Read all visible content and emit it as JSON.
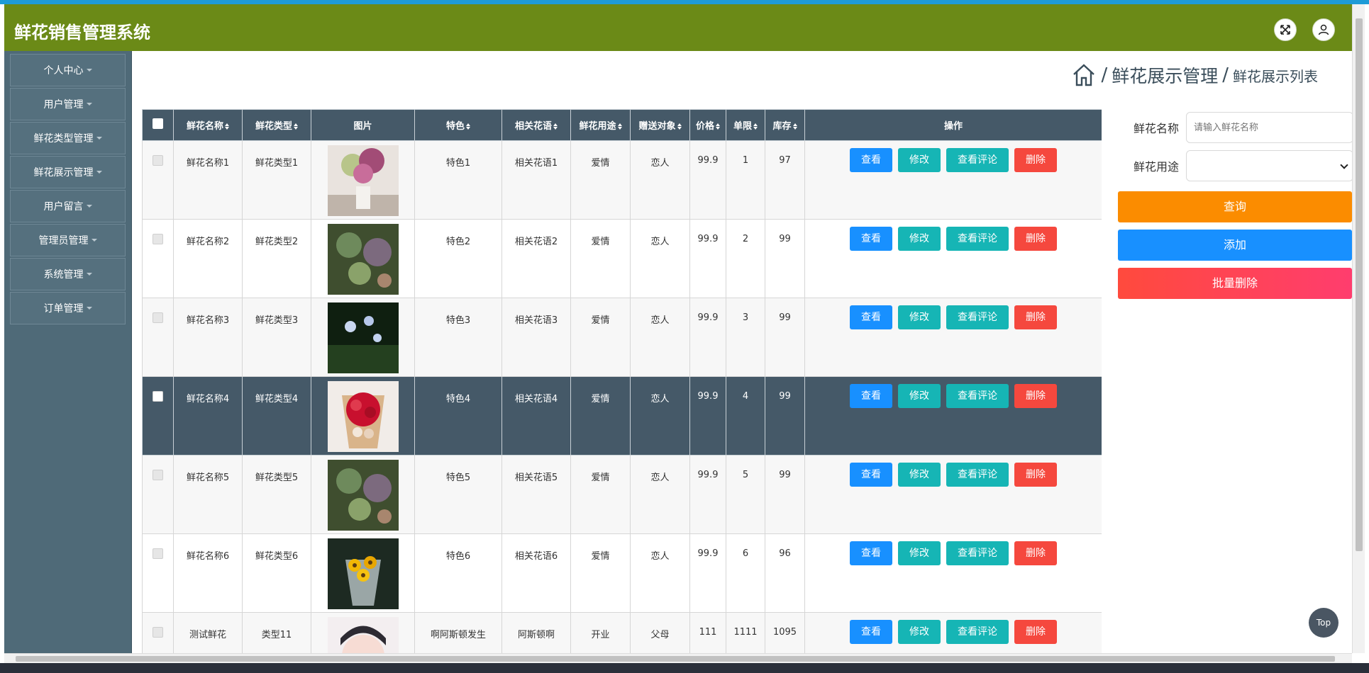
{
  "header": {
    "title": "鲜花销售管理系统"
  },
  "sidebar": {
    "items": [
      {
        "label": "个人中心"
      },
      {
        "label": "用户管理"
      },
      {
        "label": "鲜花类型管理"
      },
      {
        "label": "鲜花展示管理"
      },
      {
        "label": "用户留言"
      },
      {
        "label": "管理员管理"
      },
      {
        "label": "系统管理"
      },
      {
        "label": "订单管理"
      }
    ]
  },
  "breadcrumb": {
    "section": "鲜花展示管理",
    "page": "鲜花展示列表",
    "sep": "/"
  },
  "table": {
    "columns": [
      "鲜花名称",
      "鲜花类型",
      "图片",
      "特色",
      "相关花语",
      "鲜花用途",
      "赠送对象",
      "价格",
      "单限",
      "库存",
      "操作"
    ],
    "actions": {
      "view": "查看",
      "edit": "修改",
      "comments": "查看评论",
      "delete": "删除"
    },
    "rows": [
      {
        "name": "鲜花名称1",
        "type": "鲜花类型1",
        "feature": "特色1",
        "language": "相关花语1",
        "usage": "爱情",
        "target": "恋人",
        "price": "99.9",
        "limit": "1",
        "stock": "97"
      },
      {
        "name": "鲜花名称2",
        "type": "鲜花类型2",
        "feature": "特色2",
        "language": "相关花语2",
        "usage": "爱情",
        "target": "恋人",
        "price": "99.9",
        "limit": "2",
        "stock": "99"
      },
      {
        "name": "鲜花名称3",
        "type": "鲜花类型3",
        "feature": "特色3",
        "language": "相关花语3",
        "usage": "爱情",
        "target": "恋人",
        "price": "99.9",
        "limit": "3",
        "stock": "99"
      },
      {
        "name": "鲜花名称4",
        "type": "鲜花类型4",
        "feature": "特色4",
        "language": "相关花语4",
        "usage": "爱情",
        "target": "恋人",
        "price": "99.9",
        "limit": "4",
        "stock": "99"
      },
      {
        "name": "鲜花名称5",
        "type": "鲜花类型5",
        "feature": "特色5",
        "language": "相关花语5",
        "usage": "爱情",
        "target": "恋人",
        "price": "99.9",
        "limit": "5",
        "stock": "99"
      },
      {
        "name": "鲜花名称6",
        "type": "鲜花类型6",
        "feature": "特色6",
        "language": "相关花语6",
        "usage": "爱情",
        "target": "恋人",
        "price": "99.9",
        "limit": "6",
        "stock": "96"
      },
      {
        "name": "测试鲜花",
        "type": "类型11",
        "feature": "啊阿斯顿发生",
        "language": "阿斯顿啊",
        "usage": "开业",
        "target": "父母",
        "price": "111",
        "limit": "1111",
        "stock": "1095"
      }
    ]
  },
  "search": {
    "name_label": "鲜花名称",
    "name_placeholder": "请输入鲜花名称",
    "usage_label": "鲜花用途",
    "usage_value": ""
  },
  "panel_buttons": {
    "query": "查询",
    "add": "添加",
    "batch_delete": "批量删除"
  },
  "top_button": "Top",
  "colors": {
    "header": "#6b8a17",
    "sidebar": "#4f6a78",
    "table_header": "#455968",
    "primary": "#1890ff",
    "teal": "#16b5b5",
    "danger": "#f5483e",
    "orange": "#fb8c00"
  }
}
